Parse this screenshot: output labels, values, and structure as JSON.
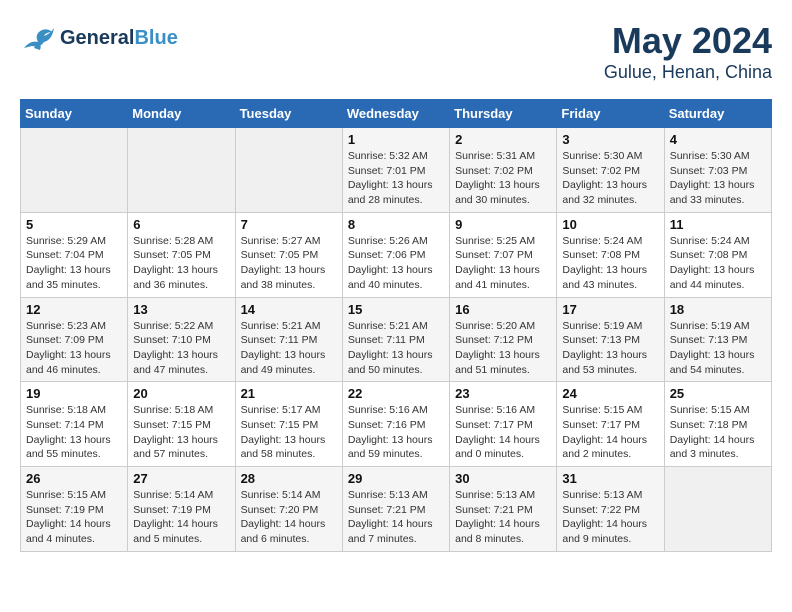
{
  "header": {
    "logo_line1": "General",
    "logo_line2": "Blue",
    "title": "May 2024",
    "subtitle": "Gulue, Henan, China"
  },
  "weekdays": [
    "Sunday",
    "Monday",
    "Tuesday",
    "Wednesday",
    "Thursday",
    "Friday",
    "Saturday"
  ],
  "weeks": [
    [
      {
        "day": "",
        "info": ""
      },
      {
        "day": "",
        "info": ""
      },
      {
        "day": "",
        "info": ""
      },
      {
        "day": "1",
        "info": "Sunrise: 5:32 AM\nSunset: 7:01 PM\nDaylight: 13 hours\nand 28 minutes."
      },
      {
        "day": "2",
        "info": "Sunrise: 5:31 AM\nSunset: 7:02 PM\nDaylight: 13 hours\nand 30 minutes."
      },
      {
        "day": "3",
        "info": "Sunrise: 5:30 AM\nSunset: 7:02 PM\nDaylight: 13 hours\nand 32 minutes."
      },
      {
        "day": "4",
        "info": "Sunrise: 5:30 AM\nSunset: 7:03 PM\nDaylight: 13 hours\nand 33 minutes."
      }
    ],
    [
      {
        "day": "5",
        "info": "Sunrise: 5:29 AM\nSunset: 7:04 PM\nDaylight: 13 hours\nand 35 minutes."
      },
      {
        "day": "6",
        "info": "Sunrise: 5:28 AM\nSunset: 7:05 PM\nDaylight: 13 hours\nand 36 minutes."
      },
      {
        "day": "7",
        "info": "Sunrise: 5:27 AM\nSunset: 7:05 PM\nDaylight: 13 hours\nand 38 minutes."
      },
      {
        "day": "8",
        "info": "Sunrise: 5:26 AM\nSunset: 7:06 PM\nDaylight: 13 hours\nand 40 minutes."
      },
      {
        "day": "9",
        "info": "Sunrise: 5:25 AM\nSunset: 7:07 PM\nDaylight: 13 hours\nand 41 minutes."
      },
      {
        "day": "10",
        "info": "Sunrise: 5:24 AM\nSunset: 7:08 PM\nDaylight: 13 hours\nand 43 minutes."
      },
      {
        "day": "11",
        "info": "Sunrise: 5:24 AM\nSunset: 7:08 PM\nDaylight: 13 hours\nand 44 minutes."
      }
    ],
    [
      {
        "day": "12",
        "info": "Sunrise: 5:23 AM\nSunset: 7:09 PM\nDaylight: 13 hours\nand 46 minutes."
      },
      {
        "day": "13",
        "info": "Sunrise: 5:22 AM\nSunset: 7:10 PM\nDaylight: 13 hours\nand 47 minutes."
      },
      {
        "day": "14",
        "info": "Sunrise: 5:21 AM\nSunset: 7:11 PM\nDaylight: 13 hours\nand 49 minutes."
      },
      {
        "day": "15",
        "info": "Sunrise: 5:21 AM\nSunset: 7:11 PM\nDaylight: 13 hours\nand 50 minutes."
      },
      {
        "day": "16",
        "info": "Sunrise: 5:20 AM\nSunset: 7:12 PM\nDaylight: 13 hours\nand 51 minutes."
      },
      {
        "day": "17",
        "info": "Sunrise: 5:19 AM\nSunset: 7:13 PM\nDaylight: 13 hours\nand 53 minutes."
      },
      {
        "day": "18",
        "info": "Sunrise: 5:19 AM\nSunset: 7:13 PM\nDaylight: 13 hours\nand 54 minutes."
      }
    ],
    [
      {
        "day": "19",
        "info": "Sunrise: 5:18 AM\nSunset: 7:14 PM\nDaylight: 13 hours\nand 55 minutes."
      },
      {
        "day": "20",
        "info": "Sunrise: 5:18 AM\nSunset: 7:15 PM\nDaylight: 13 hours\nand 57 minutes."
      },
      {
        "day": "21",
        "info": "Sunrise: 5:17 AM\nSunset: 7:15 PM\nDaylight: 13 hours\nand 58 minutes."
      },
      {
        "day": "22",
        "info": "Sunrise: 5:16 AM\nSunset: 7:16 PM\nDaylight: 13 hours\nand 59 minutes."
      },
      {
        "day": "23",
        "info": "Sunrise: 5:16 AM\nSunset: 7:17 PM\nDaylight: 14 hours\nand 0 minutes."
      },
      {
        "day": "24",
        "info": "Sunrise: 5:15 AM\nSunset: 7:17 PM\nDaylight: 14 hours\nand 2 minutes."
      },
      {
        "day": "25",
        "info": "Sunrise: 5:15 AM\nSunset: 7:18 PM\nDaylight: 14 hours\nand 3 minutes."
      }
    ],
    [
      {
        "day": "26",
        "info": "Sunrise: 5:15 AM\nSunset: 7:19 PM\nDaylight: 14 hours\nand 4 minutes."
      },
      {
        "day": "27",
        "info": "Sunrise: 5:14 AM\nSunset: 7:19 PM\nDaylight: 14 hours\nand 5 minutes."
      },
      {
        "day": "28",
        "info": "Sunrise: 5:14 AM\nSunset: 7:20 PM\nDaylight: 14 hours\nand 6 minutes."
      },
      {
        "day": "29",
        "info": "Sunrise: 5:13 AM\nSunset: 7:21 PM\nDaylight: 14 hours\nand 7 minutes."
      },
      {
        "day": "30",
        "info": "Sunrise: 5:13 AM\nSunset: 7:21 PM\nDaylight: 14 hours\nand 8 minutes."
      },
      {
        "day": "31",
        "info": "Sunrise: 5:13 AM\nSunset: 7:22 PM\nDaylight: 14 hours\nand 9 minutes."
      },
      {
        "day": "",
        "info": ""
      }
    ]
  ]
}
